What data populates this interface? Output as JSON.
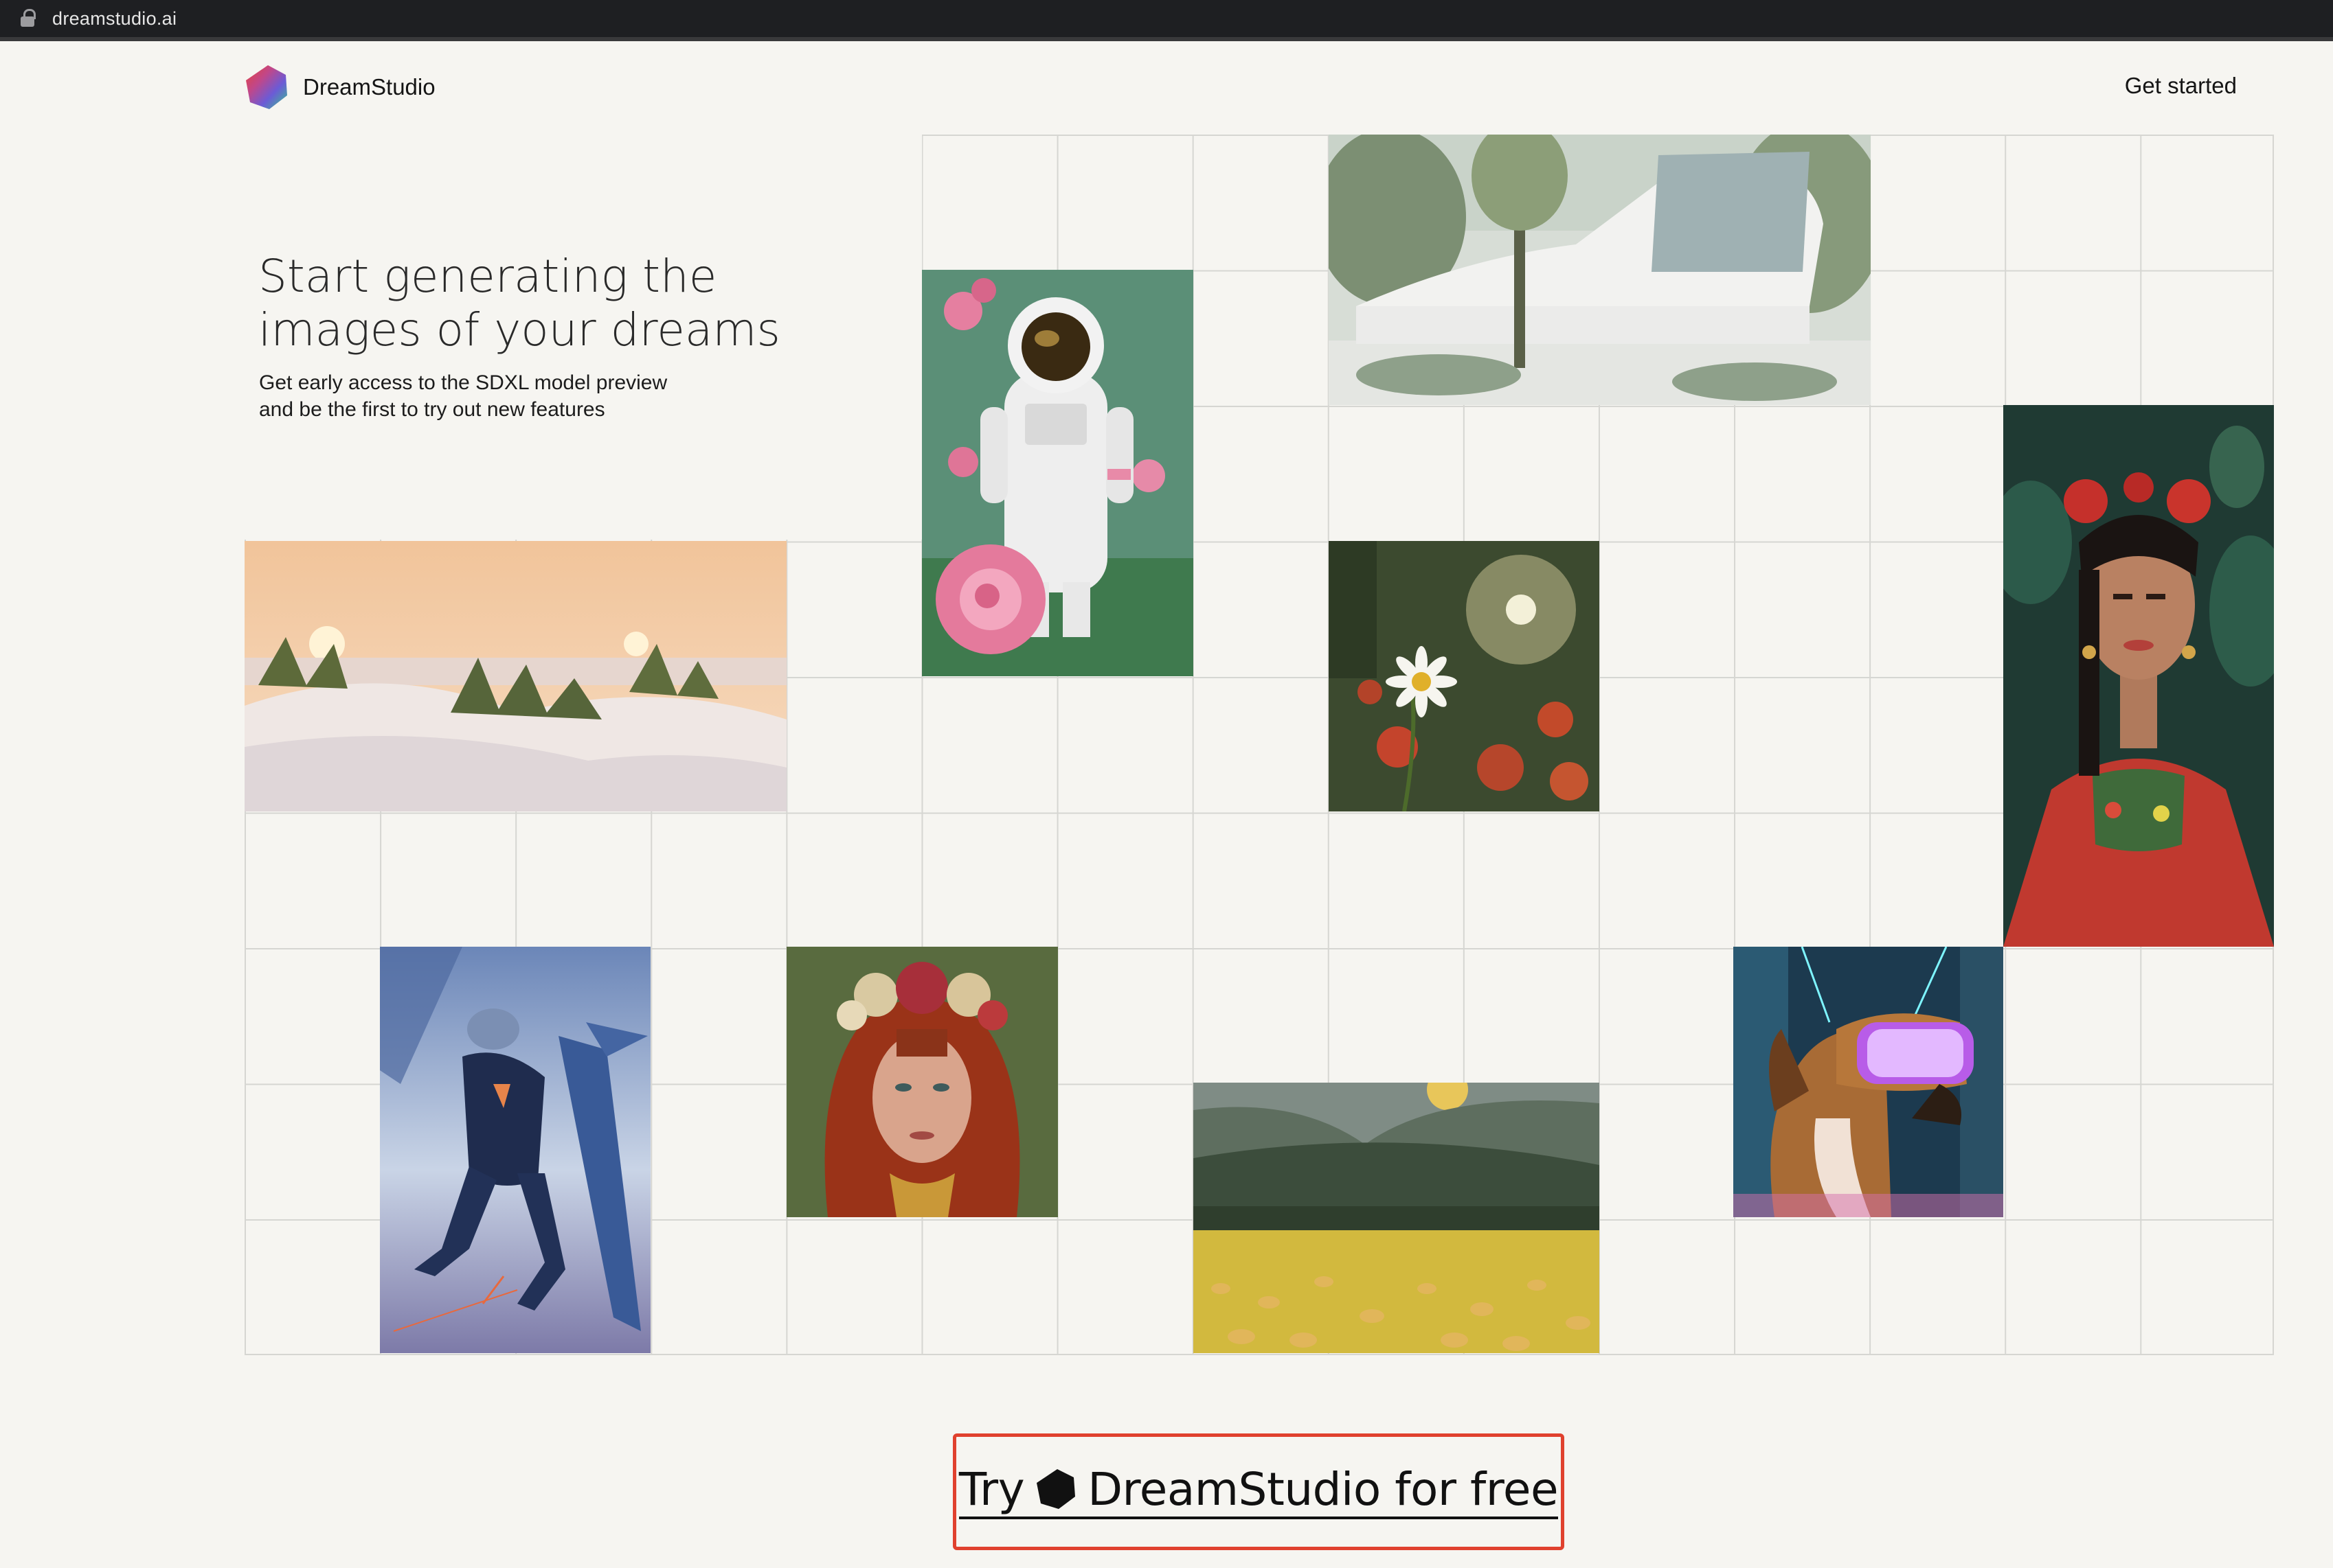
{
  "browser": {
    "url": "dreamstudio.ai"
  },
  "header": {
    "brand": "DreamStudio",
    "get_started": "Get started"
  },
  "hero": {
    "title_line1": "Start generating the",
    "title_line2": "images of your dreams",
    "subtitle_line1": "Get early access to the SDXL model preview",
    "subtitle_line2": "and be the first to try out new features"
  },
  "cta": {
    "label_before": "Try",
    "label_after": "DreamStudio for free"
  },
  "colors": {
    "background": "#f6f5f1",
    "grid_line": "#d6d6d2",
    "cta_border": "#e0412e",
    "browser_bar": "#1e1f22"
  },
  "gallery": [
    {
      "name": "astronaut-roses-image"
    },
    {
      "name": "modern-house-image"
    },
    {
      "name": "sand-dunes-sunset-image"
    },
    {
      "name": "daisy-flower-image"
    },
    {
      "name": "woman-flower-crown-portrait-image"
    },
    {
      "name": "armored-flyer-image"
    },
    {
      "name": "red-haired-woman-image"
    },
    {
      "name": "flower-field-valley-image"
    },
    {
      "name": "dog-vr-headset-image"
    }
  ]
}
